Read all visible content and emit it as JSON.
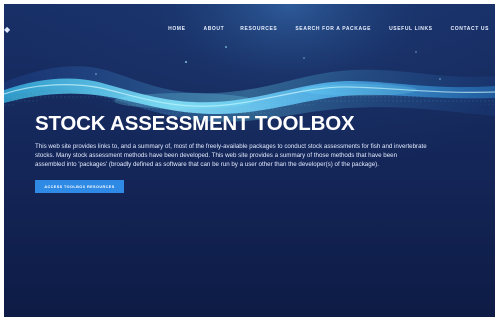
{
  "brand": {
    "logo_icon": "site-logo-icon"
  },
  "nav": {
    "items": [
      {
        "label": "HOME"
      },
      {
        "label": "ABOUT"
      },
      {
        "label": "RESOURCES"
      },
      {
        "label": "SEARCH FOR A PACKAGE"
      },
      {
        "label": "USEFUL LINKS"
      },
      {
        "label": "CONTACT US"
      }
    ]
  },
  "hero": {
    "title": "STOCK ASSESSMENT TOOLBOX",
    "description": "This web site provides links to, and a summary of, most of the freely-available packages to conduct stock assessments for fish and invertebrate stocks. Many stock assessment methods have been developed. This web site provides a summary of those methods that have been assembled into 'packages' (broadly defined as software that can be run by a user other than the developer(s) of the package).",
    "button_label": "ACCESS TOOLBOX RESOURCES"
  },
  "colors": {
    "background": "#101e47",
    "wave": "#49d8ff",
    "button": "#2f8ae6"
  }
}
